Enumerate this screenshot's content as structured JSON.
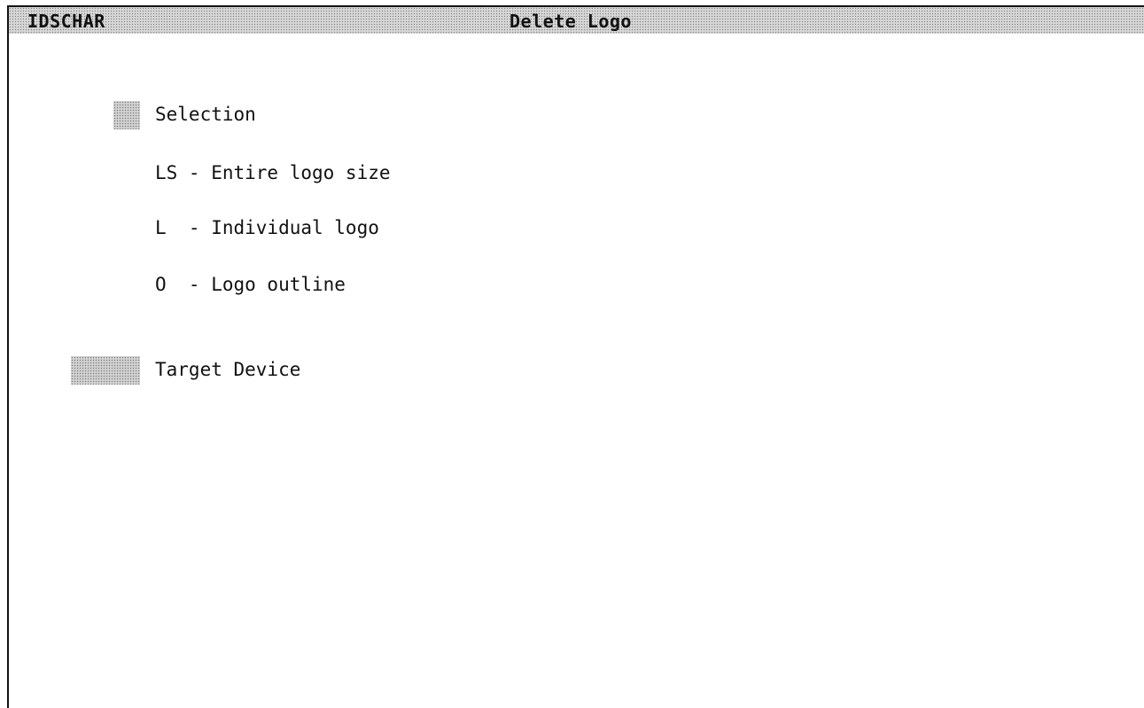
{
  "header": {
    "program": "IDSCHAR",
    "title": "Delete Logo"
  },
  "selection": {
    "label": "Selection",
    "options": [
      "LS - Entire logo size",
      "L  - Individual logo",
      "O  - Logo outline"
    ]
  },
  "target_device": {
    "label": "Target Device"
  },
  "colors": {
    "background": "#ffffff",
    "text": "#111111",
    "shaded_field": "#d4d4d4"
  }
}
